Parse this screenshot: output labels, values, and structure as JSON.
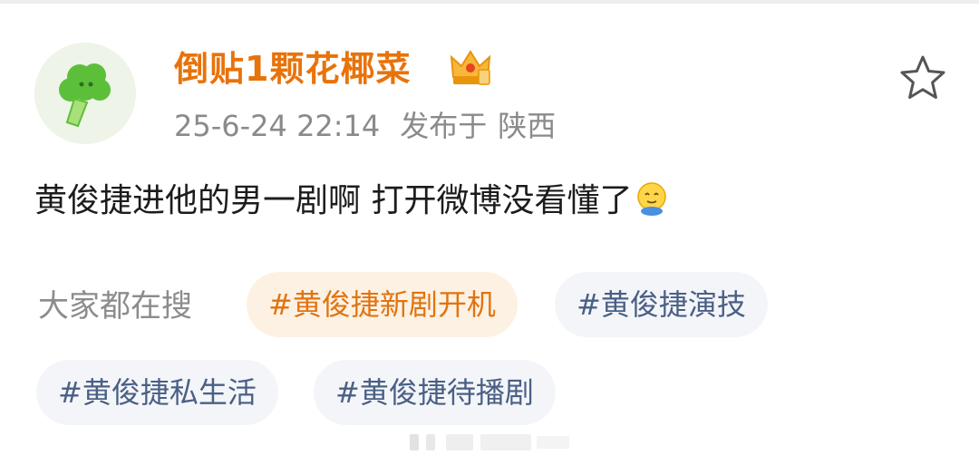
{
  "post": {
    "username": "倒贴1颗花椰菜",
    "timestamp": "25-6-24 22:14",
    "published_prefix": "发布于",
    "location": "陕西",
    "content": "黄俊捷进他的男一剧啊 打开微博没看懂了",
    "content_emoji": "sweat-smile-emoji"
  },
  "search": {
    "label": "大家都在搜",
    "tags": [
      {
        "text": "#黄俊捷新剧开机",
        "hot": true
      },
      {
        "text": "#黄俊捷演技",
        "hot": false
      },
      {
        "text": "#黄俊捷私生活",
        "hot": false
      },
      {
        "text": "#黄俊捷待播剧",
        "hot": false
      }
    ]
  },
  "icons": {
    "avatar": "broccoli-avatar",
    "badge": "crown-icon",
    "favorite": "star-icon"
  },
  "colors": {
    "username": "#e8730a",
    "hot_tag_bg": "#fdf1e3",
    "hot_tag_text": "#e0740f",
    "tag_bg": "#f3f5f8",
    "tag_text": "#4a5f85",
    "meta_text": "#8a8a8a"
  }
}
